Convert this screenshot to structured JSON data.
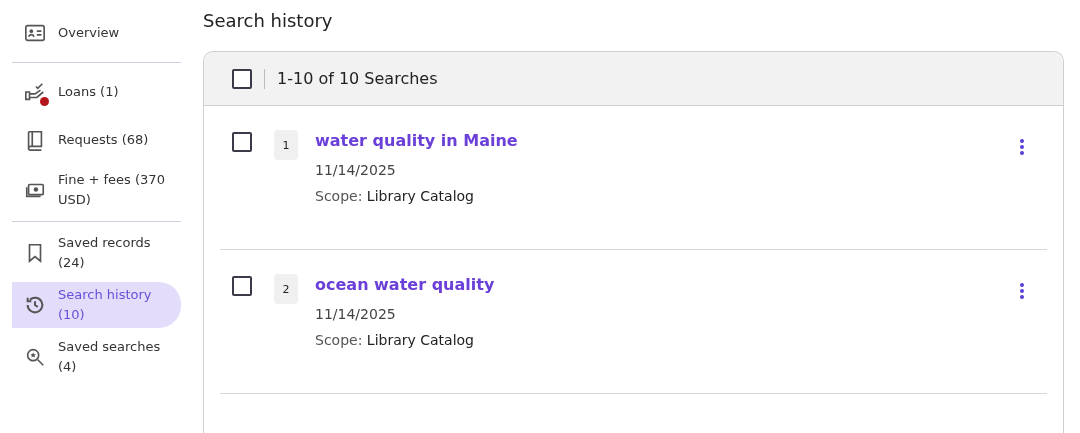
{
  "sidebar": {
    "groups": [
      {
        "items": [
          {
            "kind": "overview",
            "label": "Overview",
            "selected": false,
            "alert": false
          }
        ]
      },
      {
        "items": [
          {
            "kind": "loans",
            "label": "Loans (1)",
            "selected": false,
            "alert": true
          },
          {
            "kind": "requests",
            "label": "Requests (68)",
            "selected": false,
            "alert": false
          },
          {
            "kind": "fines",
            "label": "Fine + fees (370 USD)",
            "selected": false,
            "alert": false
          }
        ]
      },
      {
        "items": [
          {
            "kind": "saved-records",
            "label": "Saved records (24)",
            "selected": false,
            "alert": false
          },
          {
            "kind": "history",
            "label": "Search history (10)",
            "selected": true,
            "alert": false
          },
          {
            "kind": "saved-searches",
            "label": "Saved searches (4)",
            "selected": false,
            "alert": false
          }
        ]
      }
    ]
  },
  "page_title": "Search history",
  "results": {
    "select_all_checked": false,
    "summary": "1-10 of 10 Searches",
    "rows": [
      {
        "checked": false,
        "number": "1",
        "query": "water quality in Maine",
        "date": "11/14/2025",
        "scope_label": "Scope:",
        "scope": "Library Catalog"
      },
      {
        "checked": false,
        "number": "2",
        "query": "ocean water quality",
        "date": "11/14/2025",
        "scope_label": "Scope:",
        "scope": "Library Catalog"
      }
    ]
  }
}
